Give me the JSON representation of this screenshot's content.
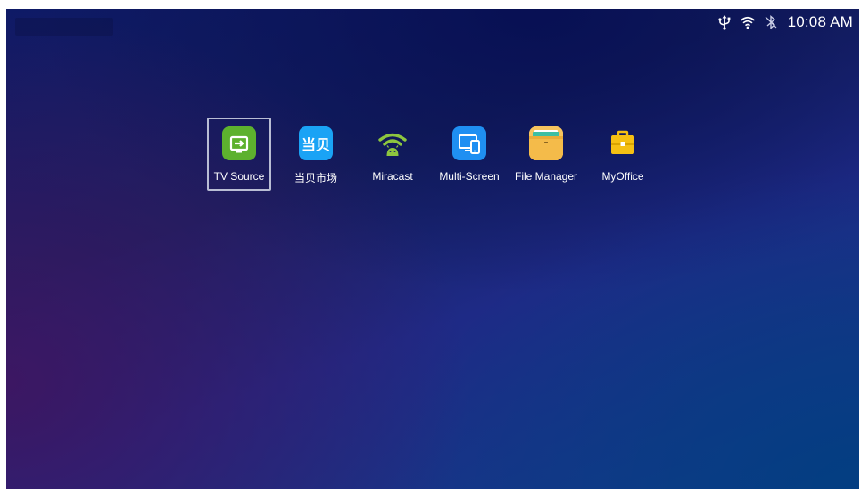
{
  "status_bar": {
    "time": "10:08 AM",
    "icons": [
      "usb-icon",
      "wifi-icon",
      "bluetooth-icon"
    ]
  },
  "apps": [
    {
      "label": "TV Source",
      "icon": "tv-source-icon",
      "selected": true
    },
    {
      "label": "当贝市场",
      "icon": "dangbei-market-icon",
      "icon_text": "当贝"
    },
    {
      "label": "Miracast",
      "icon": "miracast-icon"
    },
    {
      "label": "Multi-Screen",
      "icon": "multi-screen-icon"
    },
    {
      "label": "File Manager",
      "icon": "file-manager-icon"
    },
    {
      "label": "MyOffice",
      "icon": "myoffice-icon"
    }
  ],
  "colors": {
    "tv_source": "#5db12e",
    "dangbei": "#1aa3f5",
    "multi_screen": "#1f8ff2",
    "file_manager": "#f6c45e",
    "myoffice": "#f5c013",
    "miracast": "#8dc63f"
  }
}
